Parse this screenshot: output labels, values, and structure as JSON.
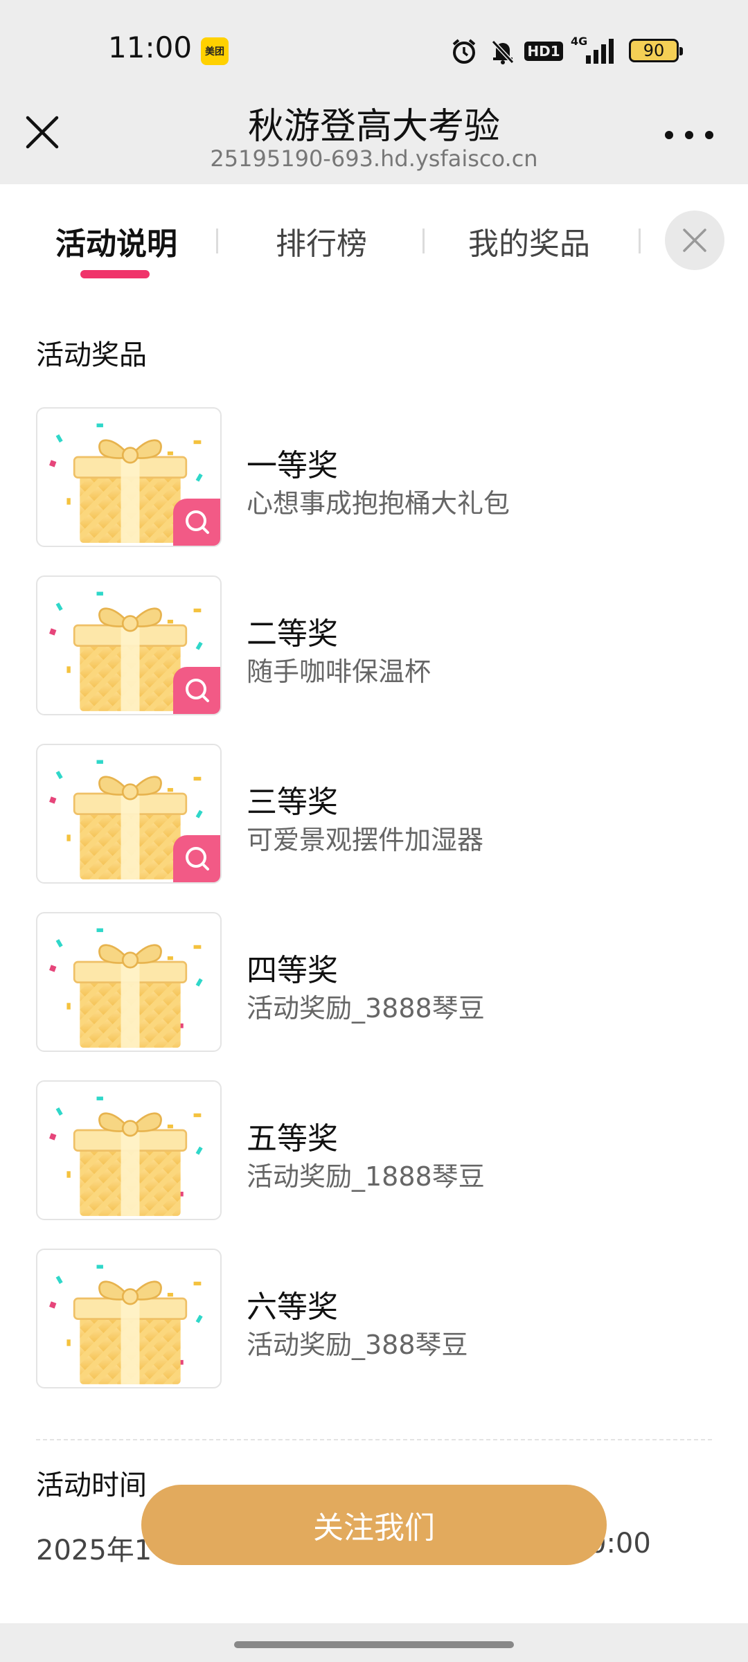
{
  "status_bar": {
    "time": "11:00",
    "app_badge": "美团",
    "network": "4G",
    "hd_badge": "HD1",
    "battery": "90",
    "icons": [
      "alarm-icon",
      "mute-bell-icon",
      "hd-icon",
      "signal-icon",
      "battery-icon"
    ]
  },
  "title_bar": {
    "title": "秋游登高大考验",
    "url": "25195190-693.hd.ysfaisco.cn",
    "close_icon": "close-icon",
    "more_icon": "more-icon"
  },
  "tabs": [
    {
      "label": "活动说明",
      "active": true
    },
    {
      "label": "排行榜",
      "active": false
    },
    {
      "label": "我的奖品",
      "active": false
    }
  ],
  "accent_color": "#f0336a",
  "prizes_section": {
    "heading": "活动奖品",
    "items": [
      {
        "name": "一等奖",
        "desc": "心想事成抱抱桶大礼包",
        "zoom": true
      },
      {
        "name": "二等奖",
        "desc": "随手咖啡保温杯",
        "zoom": true
      },
      {
        "name": "三等奖",
        "desc": "可爱景观摆件加湿器",
        "zoom": true
      },
      {
        "name": "四等奖",
        "desc": "活动奖励_3888琴豆",
        "zoom": false
      },
      {
        "name": "五等奖",
        "desc": "活动奖励_1888琴豆",
        "zoom": false
      },
      {
        "name": "六等奖",
        "desc": "活动奖励_388琴豆",
        "zoom": false
      }
    ]
  },
  "time_section": {
    "heading": "活动时间",
    "text_left": "2025年1",
    "text_right": "0:00"
  },
  "follow_button": {
    "label": "关注我们",
    "color": "#e2aa5d"
  }
}
